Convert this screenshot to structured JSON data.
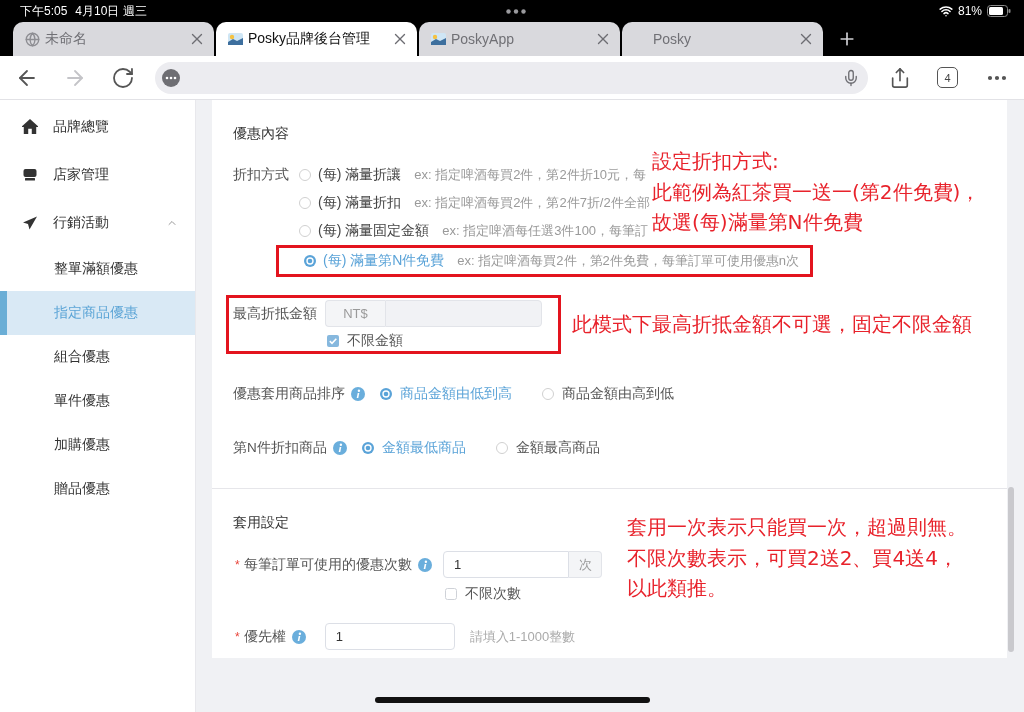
{
  "status_bar": {
    "time": "下午5:05",
    "date": "4月10日 週三",
    "battery": "81%"
  },
  "browser_tabs": [
    {
      "title": "未命名",
      "selected": false
    },
    {
      "title": "Posky品牌後台管理",
      "selected": true
    },
    {
      "title": "PoskyApp",
      "selected": false
    },
    {
      "title": "Posky",
      "selected": false
    }
  ],
  "toolbar": {
    "forward_disabled": true,
    "tab_count": "4"
  },
  "sidebar": {
    "items": [
      {
        "label": "品牌總覽",
        "selected": false
      },
      {
        "label": "店家管理",
        "selected": false
      },
      {
        "label": "行銷活動",
        "selected": false,
        "expanded": true,
        "children": [
          {
            "label": "整單滿額優惠",
            "selected": false
          },
          {
            "label": "指定商品優惠",
            "selected": true
          },
          {
            "label": "組合優惠",
            "selected": false
          },
          {
            "label": "單件優惠",
            "selected": false
          },
          {
            "label": "加購優惠",
            "selected": false
          },
          {
            "label": "贈品優惠",
            "selected": false
          }
        ]
      }
    ]
  },
  "promo_content": {
    "title": "優惠內容",
    "discount_method": {
      "label": "折扣方式",
      "options": [
        {
          "label": "(每) 滿量折讓",
          "example": "ex: 指定啤酒每買2件，第2件折10元，每",
          "selected": false,
          "highlighted": false
        },
        {
          "label": "(每) 滿量折扣",
          "example": "ex: 指定啤酒每買2件，第2件7折/2件全部",
          "selected": false,
          "highlighted": false
        },
        {
          "label": "(每) 滿量固定金額",
          "example": "ex: 指定啤酒每任選3件100，每筆訂",
          "selected": false,
          "highlighted": false
        },
        {
          "label": "(每) 滿量第N件免費",
          "example": "ex: 指定啤酒每買2件，第2件免費，每筆訂單可使用優惠n次",
          "selected": true,
          "highlighted": true
        }
      ],
      "annotation": [
        "設定折扣方式:",
        "此範例為紅茶買一送一(第2件免費)，",
        "故選(每)滿量第N件免費"
      ]
    },
    "max_discount": {
      "label": "最高折抵金額",
      "prefix": "NT$",
      "disabled": true,
      "highlighted": true,
      "unlimited": {
        "label": "不限金額",
        "checked": true
      },
      "annotation": "此模式下最高折抵金額不可選，固定不限金額"
    },
    "sort_order": {
      "label": "優惠套用商品排序",
      "options": [
        {
          "label": "商品金額由低到高",
          "selected": true
        },
        {
          "label": "商品金額由高到低",
          "selected": false
        }
      ]
    },
    "nth_item": {
      "label": "第N件折扣商品",
      "options": [
        {
          "label": "金額最低商品",
          "selected": true
        },
        {
          "label": "金額最高商品",
          "selected": false
        }
      ]
    }
  },
  "apply_settings": {
    "title": "套用設定",
    "uses_per_order": {
      "required_mark": "*",
      "label": "每筆訂單可使用的優惠次數",
      "value": "1",
      "suffix": "次",
      "unlimited": {
        "label": "不限次數",
        "checked": false
      }
    },
    "priority": {
      "required_mark": "*",
      "label": "優先權",
      "value": "1",
      "hint": "請填入1-1000整數"
    },
    "annotation": [
      "套用一次表示只能買一次，超過則無。",
      "不限次數表示，可買2送2、買4送4，",
      "以此類推。"
    ]
  }
}
